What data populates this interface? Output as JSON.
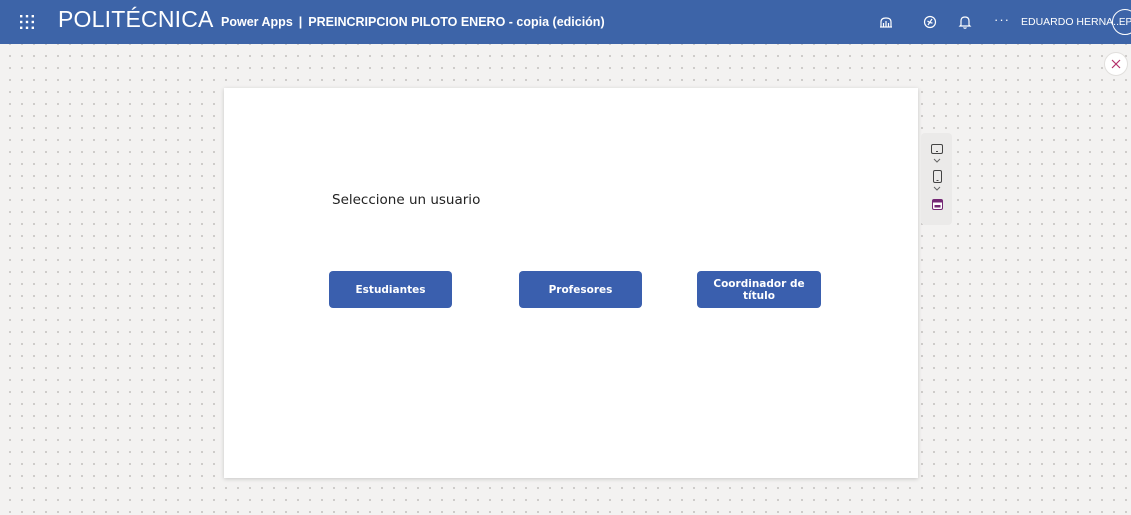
{
  "topbar": {
    "brand": "POLITÉCNICA",
    "app_label": "Power Apps",
    "separator": "|",
    "document_title": "PREINCRIPCION PILOTO ENERO - copia (edición)",
    "more": "···",
    "user_name": "EDUARDO HERNA...",
    "avatar_initials": "EP",
    "icons": [
      "app-launcher-icon",
      "copilot-icon",
      "settings-icon",
      "notifications-icon",
      "more-icon"
    ]
  },
  "canvas": {
    "prompt": "Seleccione un usuario",
    "buttons": {
      "students": "Estudiantes",
      "teachers": "Profesores",
      "coordinator": "Coordinador de título"
    }
  },
  "side_toolbar": {
    "icons": [
      "tablet-view-icon",
      "phone-view-icon",
      "calendar-view-icon"
    ]
  },
  "colors": {
    "topbar_bg": "#3d64a8",
    "button_bg": "#3a5fae",
    "canvas_bg": "#f3f2f1",
    "selected_view": "#742774"
  }
}
